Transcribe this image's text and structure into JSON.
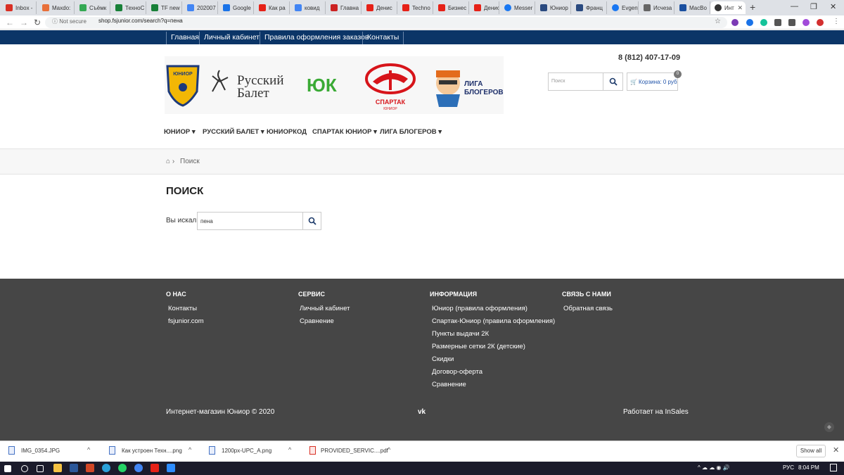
{
  "browser": {
    "tabs": [
      "Inbox -",
      "Maxdo:",
      "Съёмк",
      "ТехноС",
      "TF new",
      "202007",
      "Google",
      "Как ра",
      "ковид",
      "Главна",
      "Денис",
      "Techno",
      "Бизнес",
      "Денис",
      "Messer",
      "Юниор",
      "Франц",
      "Evgeny",
      "Исчеза",
      "MacBo",
      "Инт"
    ],
    "address": {
      "security": "Not secure",
      "url": "shop.fsjunior.com/search?q=пена"
    }
  },
  "site": {
    "topnav": [
      "Главная",
      "Личный кабинет",
      "Правила оформления заказов",
      "Контакты"
    ],
    "phone": "8 (812) 407-17-09",
    "search_placeholder": "Поиск",
    "cart": {
      "label": "Корзина: 0 руб",
      "badge": "0"
    },
    "logos": {
      "junior": "ЮНИОР",
      "ballet_line1": "Русский",
      "ballet_line2": "Балет",
      "yuk": "ЮК",
      "spartak": "СПАРТАК",
      "spartak_sub": "ЮНИОР",
      "liga_line1": "ЛИГА",
      "liga_line2": "БЛОГЕРОВ"
    },
    "menu": [
      "ЮНИОР",
      "РУССКИЙ БАЛЕТ",
      "ЮНИОРКОД",
      "СПАРТАК ЮНИОР",
      "ЛИГА БЛОГЕРОВ"
    ],
    "breadcrumb": "Поиск",
    "page_title": "ПОИСК",
    "searched_label": "Вы искали",
    "query": "пена"
  },
  "footer": {
    "columns": [
      {
        "title": "О НАС",
        "links": [
          "Контакты",
          "fsjunior.com"
        ]
      },
      {
        "title": "СЕРВИС",
        "links": [
          "Личный кабинет",
          "Сравнение"
        ]
      },
      {
        "title": "ИНФОРМАЦИЯ",
        "links": [
          "Юниор (правила оформления)",
          "Спартак-Юниор (правила оформления)",
          "Пункты выдачи 2К",
          "Размерные сетки 2К (детские)",
          "Скидки",
          "Договор-оферта",
          "Сравнение"
        ]
      },
      {
        "title": "СВЯЗЬ С НАМИ",
        "links": [
          "Обратная связь"
        ]
      }
    ],
    "copyright": "Интернет-магазин Юниор © 2020",
    "vk": "vk",
    "powered": "Работает на InSales"
  },
  "downloads": {
    "items": [
      "IMG_0354.JPG",
      "Как устроен Техн....png",
      "1200px-UPC_A.png",
      "PROVIDED_SERVIC....pdf"
    ],
    "show_all": "Show all"
  },
  "taskbar": {
    "lang": "РУС",
    "time": "8:04 PM"
  },
  "colors": {
    "nav": "#0b3567",
    "footer": "#464646",
    "cart": "#2255aa"
  }
}
